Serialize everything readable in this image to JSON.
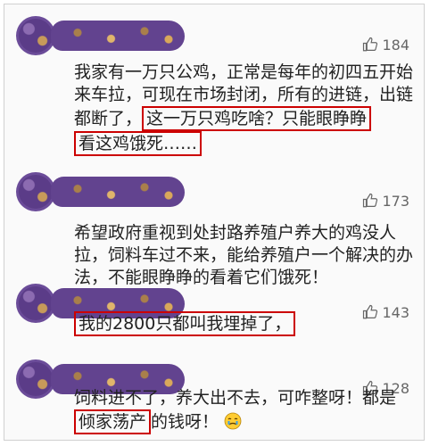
{
  "comments": [
    {
      "likes": "184",
      "text_before": "我家有一万只公鸡，正常是每年的初四五开始来车拉，可现在市场封闭，所有的进链，出链都断了，",
      "highlight_1": "这一万只鸡吃啥？只能眼睁睁",
      "highlight_2": "看这鸡饿死……"
    },
    {
      "likes": "173",
      "text": "希望政府重视到处封路养殖户养大的鸡没人拉，饲料车过不来，能给养殖户一个解决的办法，不能眼睁睁的看着它们饿死！"
    },
    {
      "likes": "143",
      "highlight": "我的2800只都叫我埋掉了，"
    },
    {
      "likes": "128",
      "text_before": "饲料进不了，养大出不去，可咋整呀！都是",
      "highlight": "倾家荡产",
      "text_after": "的钱呀！"
    }
  ],
  "icons": {
    "like": "thumbs-up-icon",
    "emoji": "crying-emoji"
  },
  "colors": {
    "highlight_border": "#cc0000",
    "avatar_purple": "#5b3c88"
  }
}
